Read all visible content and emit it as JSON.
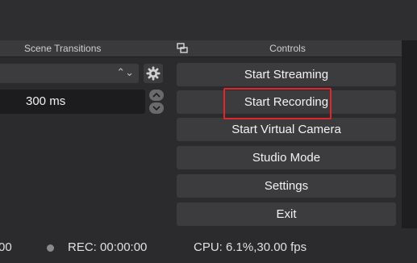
{
  "transitions": {
    "header": "Scene Transitions",
    "combo_arrows": "⌃⌄",
    "duration": "300 ms"
  },
  "controls": {
    "header": "Controls",
    "buttons": [
      "Start Streaming",
      "Start Recording",
      "Start Virtual Camera",
      "Studio Mode",
      "Settings",
      "Exit"
    ],
    "highlighted": "Start Recording",
    "highlight_color": "#e3262b"
  },
  "status": {
    "stream_time_fragment": "00",
    "rec": "REC: 00:00:00",
    "cpu": "CPU: 6.1%,30.00 fps"
  }
}
